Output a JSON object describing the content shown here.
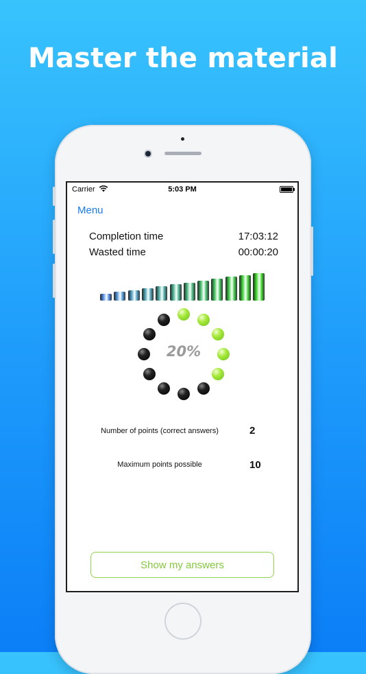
{
  "headline": "Master the material",
  "status_bar": {
    "carrier": "Carrier",
    "time": "5:03 PM"
  },
  "nav": {
    "menu_label": "Menu"
  },
  "times": [
    {
      "label": "Completion time",
      "value": "17:03:12"
    },
    {
      "label": "Wasted time",
      "value": "00:00:20"
    }
  ],
  "progress": {
    "percent_label": "20%",
    "fraction_complete": 0.2,
    "balls_total": 12,
    "balls_lit": 5
  },
  "stats": {
    "points_label": "Number of points (correct answers)",
    "points_value": "2",
    "max_label": "Maximum points possible",
    "max_value": "10"
  },
  "actions": {
    "show_answers_label": "Show my answers"
  },
  "colors": {
    "accent_blue": "#1a7cf5",
    "accent_green": "#85c93c",
    "background_top": "#38c3fd",
    "background_bottom": "#0b7ff7"
  }
}
